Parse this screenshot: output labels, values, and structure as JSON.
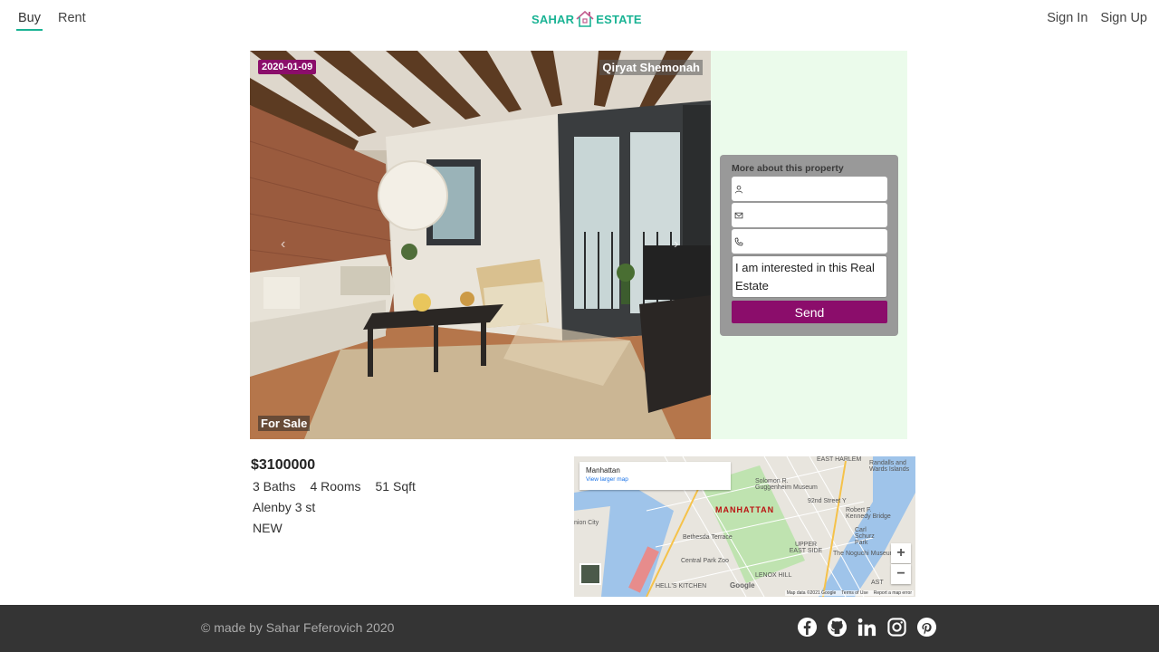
{
  "nav": {
    "buy": "Buy",
    "rent": "Rent",
    "sign_in": "Sign In",
    "sign_up": "Sign Up"
  },
  "logo": {
    "left": "SAHAR",
    "right": "ESTATE"
  },
  "listing": {
    "date": "2020-01-09",
    "city": "Qiryat Shemonah",
    "status": "For Sale",
    "price": "$3100000",
    "baths": "3 Baths",
    "rooms": "4 Rooms",
    "size": "51 Sqft",
    "address": "Alenby 3 st",
    "condition": "NEW"
  },
  "contact": {
    "title": "More about this property",
    "message": "I am interested in this Real Estate",
    "send": "Send"
  },
  "map": {
    "place": "Manhattan",
    "larger_link": "View larger map",
    "labels": {
      "manhattan": "MANHATTAN",
      "east_harlem": "EAST HARLEM",
      "randalls": "Randalls and Wards Islands",
      "guggenheim": "Solomon R. Guggenheim Museum",
      "street92": "92nd Street Y",
      "kennedy": "Robert F. Kennedy Bridge",
      "carl": "Carl Schurz Park",
      "bethesda": "Bethesda Terrace",
      "upper": "UPPER EAST SIDE",
      "noguchi": "The Noguchi Museum",
      "zoo": "Central Park Zoo",
      "lenox": "LENOX HILL",
      "hells": "HELL'S KITCHEN",
      "union": "nion City",
      "astoria": "AST"
    },
    "zoom_in": "+",
    "zoom_out": "−",
    "google": "Google",
    "map_data": "Map data ©2021 Google",
    "terms": "Terms of Use",
    "report": "Report a map error"
  },
  "footer": {
    "copyright": "© made by Sahar Feferovich 2020"
  },
  "icons": {
    "socials": [
      "facebook-icon",
      "github-icon",
      "linkedin-icon",
      "instagram-icon",
      "pinterest-icon"
    ]
  },
  "colors": {
    "accent": "#1ab394",
    "brand": "#8b0d6b",
    "footer_bg": "#343434",
    "panel_bg": "#ebfbeb"
  }
}
